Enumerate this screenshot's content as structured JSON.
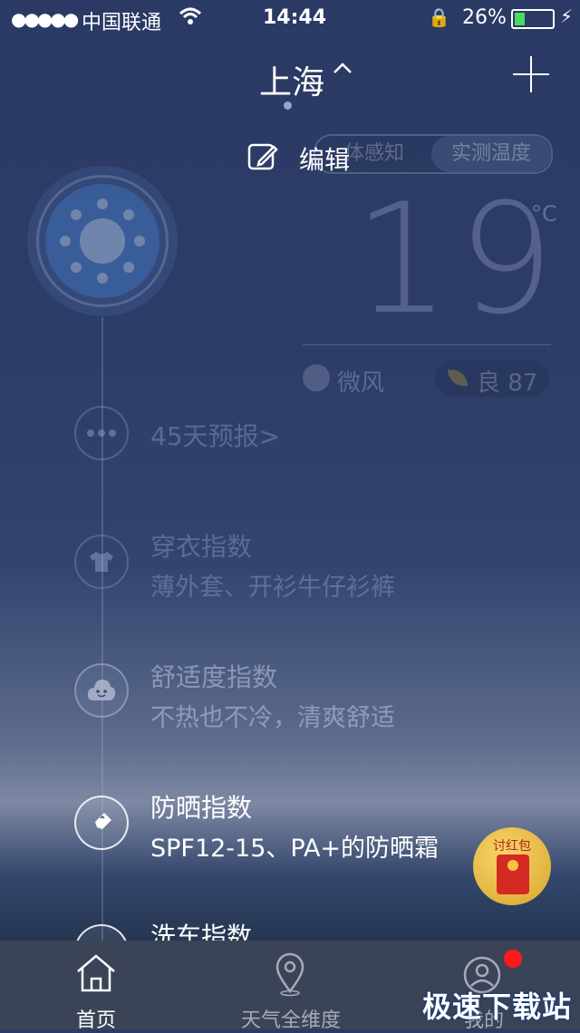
{
  "status_bar": {
    "signal": "●●●●●",
    "carrier": "中国联通",
    "time": "14:44",
    "battery_percent": "26%",
    "battery_level": 0.26
  },
  "header": {
    "city": "上海",
    "city_toggle": "^",
    "edit_label": "编辑"
  },
  "weather": {
    "toggle_left": "体感知",
    "toggle_right": "实测温度",
    "temperature": "19",
    "unit": "°C",
    "wind": "微风",
    "aqi": "良 87"
  },
  "forecast_link": "45天预报>",
  "indices": [
    {
      "title": "穿衣指数",
      "desc": "薄外套、开衫牛仔衫裤"
    },
    {
      "title": "舒适度指数",
      "desc": "不热也不冷，清爽舒适"
    },
    {
      "title": "防晒指数",
      "desc": "SPF12-15、PA+的防晒霜"
    },
    {
      "title": "洗车指数",
      "desc": ""
    }
  ],
  "red_packet_label": "讨红包",
  "tabs": [
    {
      "label": "首页"
    },
    {
      "label": "天气全维度"
    },
    {
      "label": "我的"
    }
  ],
  "watermark": "极速下载站",
  "colors": {
    "tab_active": "#ffffff",
    "tab_inactive": "#a4abbb",
    "badge": "#ff1a1a",
    "battery": "#4cd964"
  }
}
